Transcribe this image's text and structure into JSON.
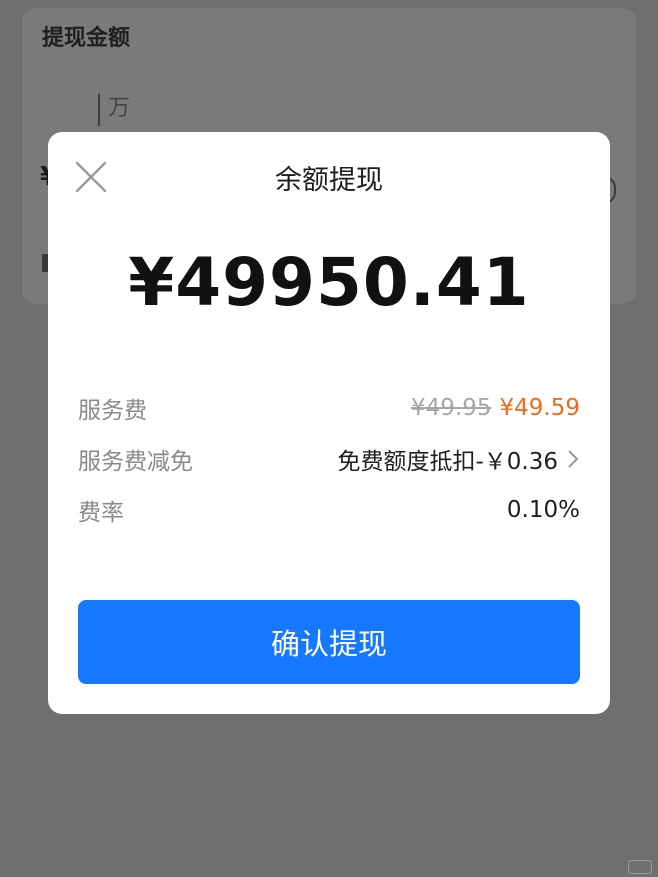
{
  "background": {
    "section_title": "提现金额",
    "input_unit": "万",
    "left_fragment": "¥"
  },
  "modal": {
    "title": "余额提现",
    "amount": "¥49950.41",
    "rows": [
      {
        "label": "服务费",
        "original": "¥49.95",
        "final": "¥49.59"
      },
      {
        "label": "服务费减免",
        "value": "免费额度抵扣-￥0.36"
      },
      {
        "label": "费率",
        "value": "0.10%"
      }
    ],
    "confirm_label": "确认提现"
  },
  "colors": {
    "accent": "#1677ff",
    "fee_highlight": "#f06a1d",
    "overlay": "#6f6f6f"
  },
  "icons": {
    "close": "close-icon",
    "chevron": "chevron-right-icon"
  }
}
